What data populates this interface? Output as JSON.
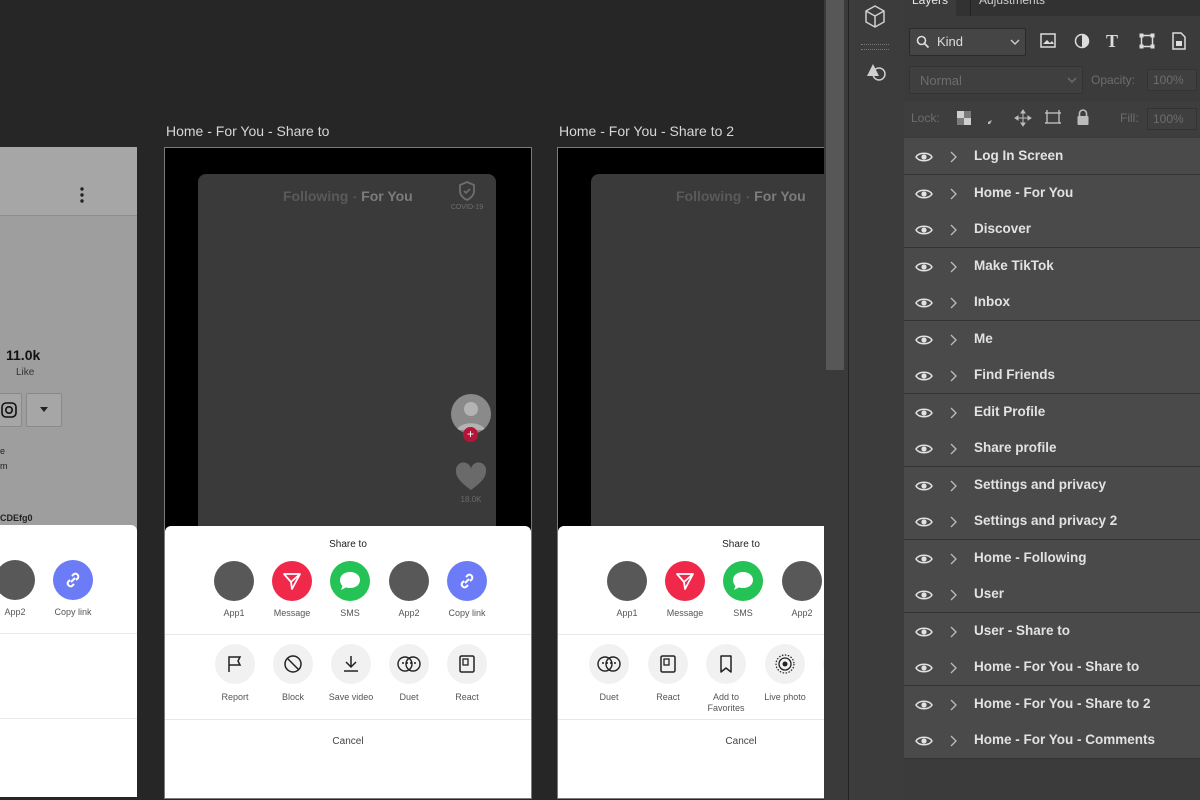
{
  "artboards": {
    "left_partial": {
      "stat_value": "11.0k",
      "stat_label": "Like",
      "text_line1": "e",
      "text_line2": "m",
      "code_text": "CDEfg0",
      "share_items": [
        {
          "label": "App2",
          "icon": "app-placeholder-icon"
        },
        {
          "label": "Copy link",
          "icon": "link-icon"
        }
      ]
    },
    "share_to": {
      "title": "Home - For You - Share to",
      "tab_following": "Following",
      "tab_for_you": "For You",
      "covid_label": "COVID-19",
      "like_count": "18.0K",
      "sheet_title": "Share to",
      "share_items": [
        {
          "label": "App1",
          "icon": "app-placeholder-icon"
        },
        {
          "label": "Message",
          "icon": "send-icon"
        },
        {
          "label": "SMS",
          "icon": "chat-bubble-icon"
        },
        {
          "label": "App2",
          "icon": "app-placeholder-icon"
        },
        {
          "label": "Copy link",
          "icon": "link-icon"
        }
      ],
      "actions": [
        {
          "label": "Report",
          "icon": "flag-icon"
        },
        {
          "label": "Block",
          "icon": "block-icon"
        },
        {
          "label": "Save video",
          "icon": "download-icon"
        },
        {
          "label": "Duet",
          "icon": "duet-icon"
        },
        {
          "label": "React",
          "icon": "react-icon"
        }
      ],
      "cancel": "Cancel"
    },
    "share_to_2": {
      "title": "Home - For You - Share to 2",
      "tab_following": "Following",
      "tab_for_you": "For You",
      "sheet_title": "Share to",
      "share_items": [
        {
          "label": "App1",
          "icon": "app-placeholder-icon"
        },
        {
          "label": "Message",
          "icon": "send-icon"
        },
        {
          "label": "SMS",
          "icon": "chat-bubble-icon"
        },
        {
          "label": "App2",
          "icon": "app-placeholder-icon"
        }
      ],
      "actions": [
        {
          "label": "Duet",
          "icon": "duet-icon"
        },
        {
          "label": "React",
          "icon": "react-icon"
        },
        {
          "label": "Add to\nFavorites",
          "icon": "bookmark-icon"
        },
        {
          "label": "Live photo",
          "icon": "live-photo-icon"
        }
      ],
      "cancel": "Cancel"
    }
  },
  "panel": {
    "tabs": [
      "Layers",
      "Adjustments"
    ],
    "filter_kind": "Kind",
    "blend_mode": "Normal",
    "opacity_label": "Opacity:",
    "opacity_value": "100%",
    "lock_label": "Lock:",
    "fill_label": "Fill:",
    "fill_value": "100%",
    "layers": [
      "Log In Screen",
      "Home - For You",
      "Discover",
      "Make TikTok",
      "Inbox",
      "Me",
      "Find Friends",
      "Edit Profile",
      "Share profile",
      "Settings and privacy",
      "Settings and privacy 2",
      "Home - Following",
      "User",
      "User - Share to",
      "Home - For You - Share to",
      "Home - For You - Share to 2",
      "Home - For You - Comments"
    ]
  },
  "colors": {
    "canvas_bg": "#262626",
    "panel_bg": "#3b3b3b",
    "layer_row_bg": "#4a4a4a",
    "message_red": "#f0284a",
    "sms_green": "#25c255",
    "link_blue": "#6b7cf6"
  }
}
